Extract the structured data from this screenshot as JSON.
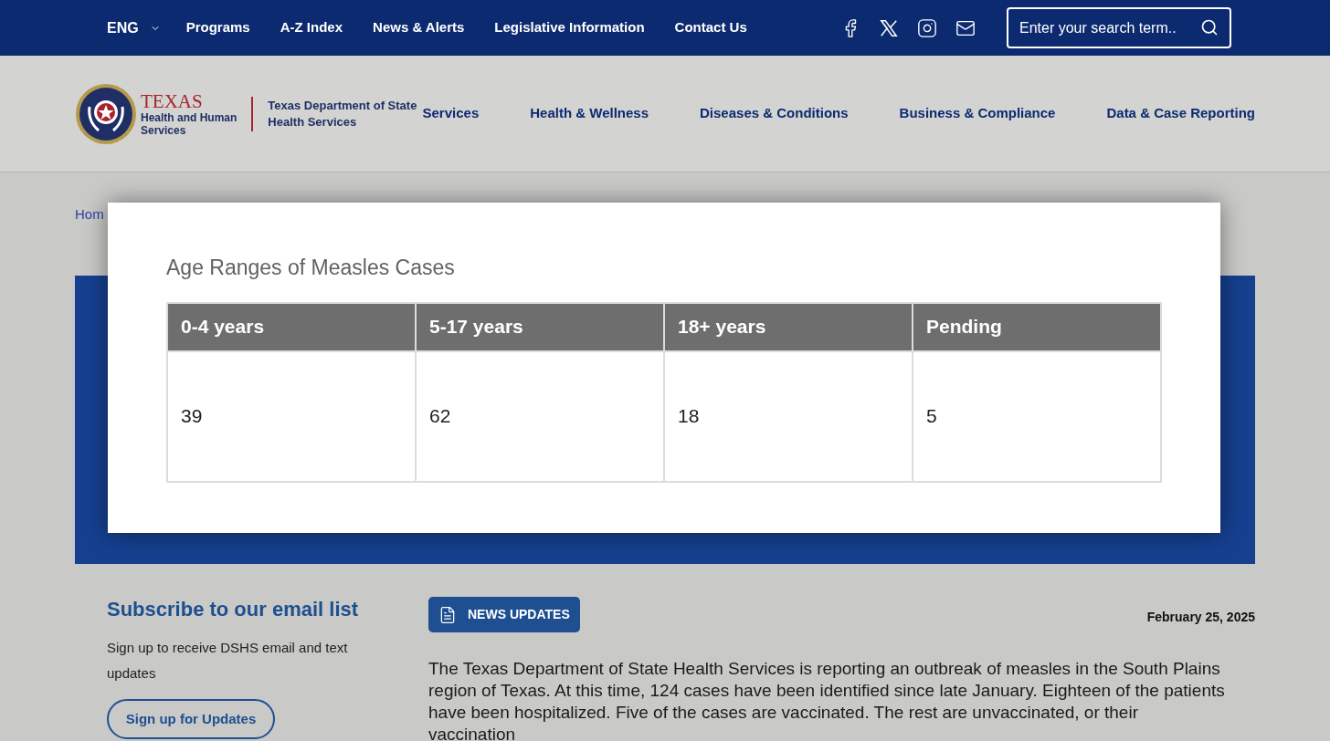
{
  "top_bar": {
    "language": "ENG",
    "links": [
      "Programs",
      "A-Z Index",
      "News & Alerts",
      "Legislative Information",
      "Contact Us"
    ],
    "search": {
      "placeholder": "Enter your search term.."
    }
  },
  "header": {
    "logo": {
      "title": "TEXAS",
      "subtitle_lines": [
        "Health and Human",
        "Services"
      ],
      "agency_lines": [
        "Texas Department of State",
        "Health Services"
      ]
    },
    "nav": [
      "Services",
      "Health & Wellness",
      "Diseases & Conditions",
      "Business & Compliance",
      "Data & Case Reporting"
    ]
  },
  "breadcrumb": "Hom",
  "popup": {
    "title": "Age Ranges of Measles Cases",
    "table": {
      "columns": [
        "0-4 years",
        "5-17 years",
        "18+ years",
        "Pending"
      ],
      "rows": [
        [
          "39",
          "62",
          "18",
          "5"
        ]
      ]
    }
  },
  "subscribe": {
    "heading": "Subscribe to our email list",
    "text": "Sign up to receive DSHS email and text updates",
    "button": "Sign up for Updates"
  },
  "news": {
    "badge": "NEWS UPDATES",
    "date": "February 25, 2025",
    "paragraph": "The Texas Department of State Health Services is reporting an outbreak of measles in the South Plains region of Texas. At this time, 124 cases have been identified since late January. Eighteen of the patients have been hospitalized. Five of the cases are vaccinated. The rest are unvaccinated, or their vaccination"
  }
}
